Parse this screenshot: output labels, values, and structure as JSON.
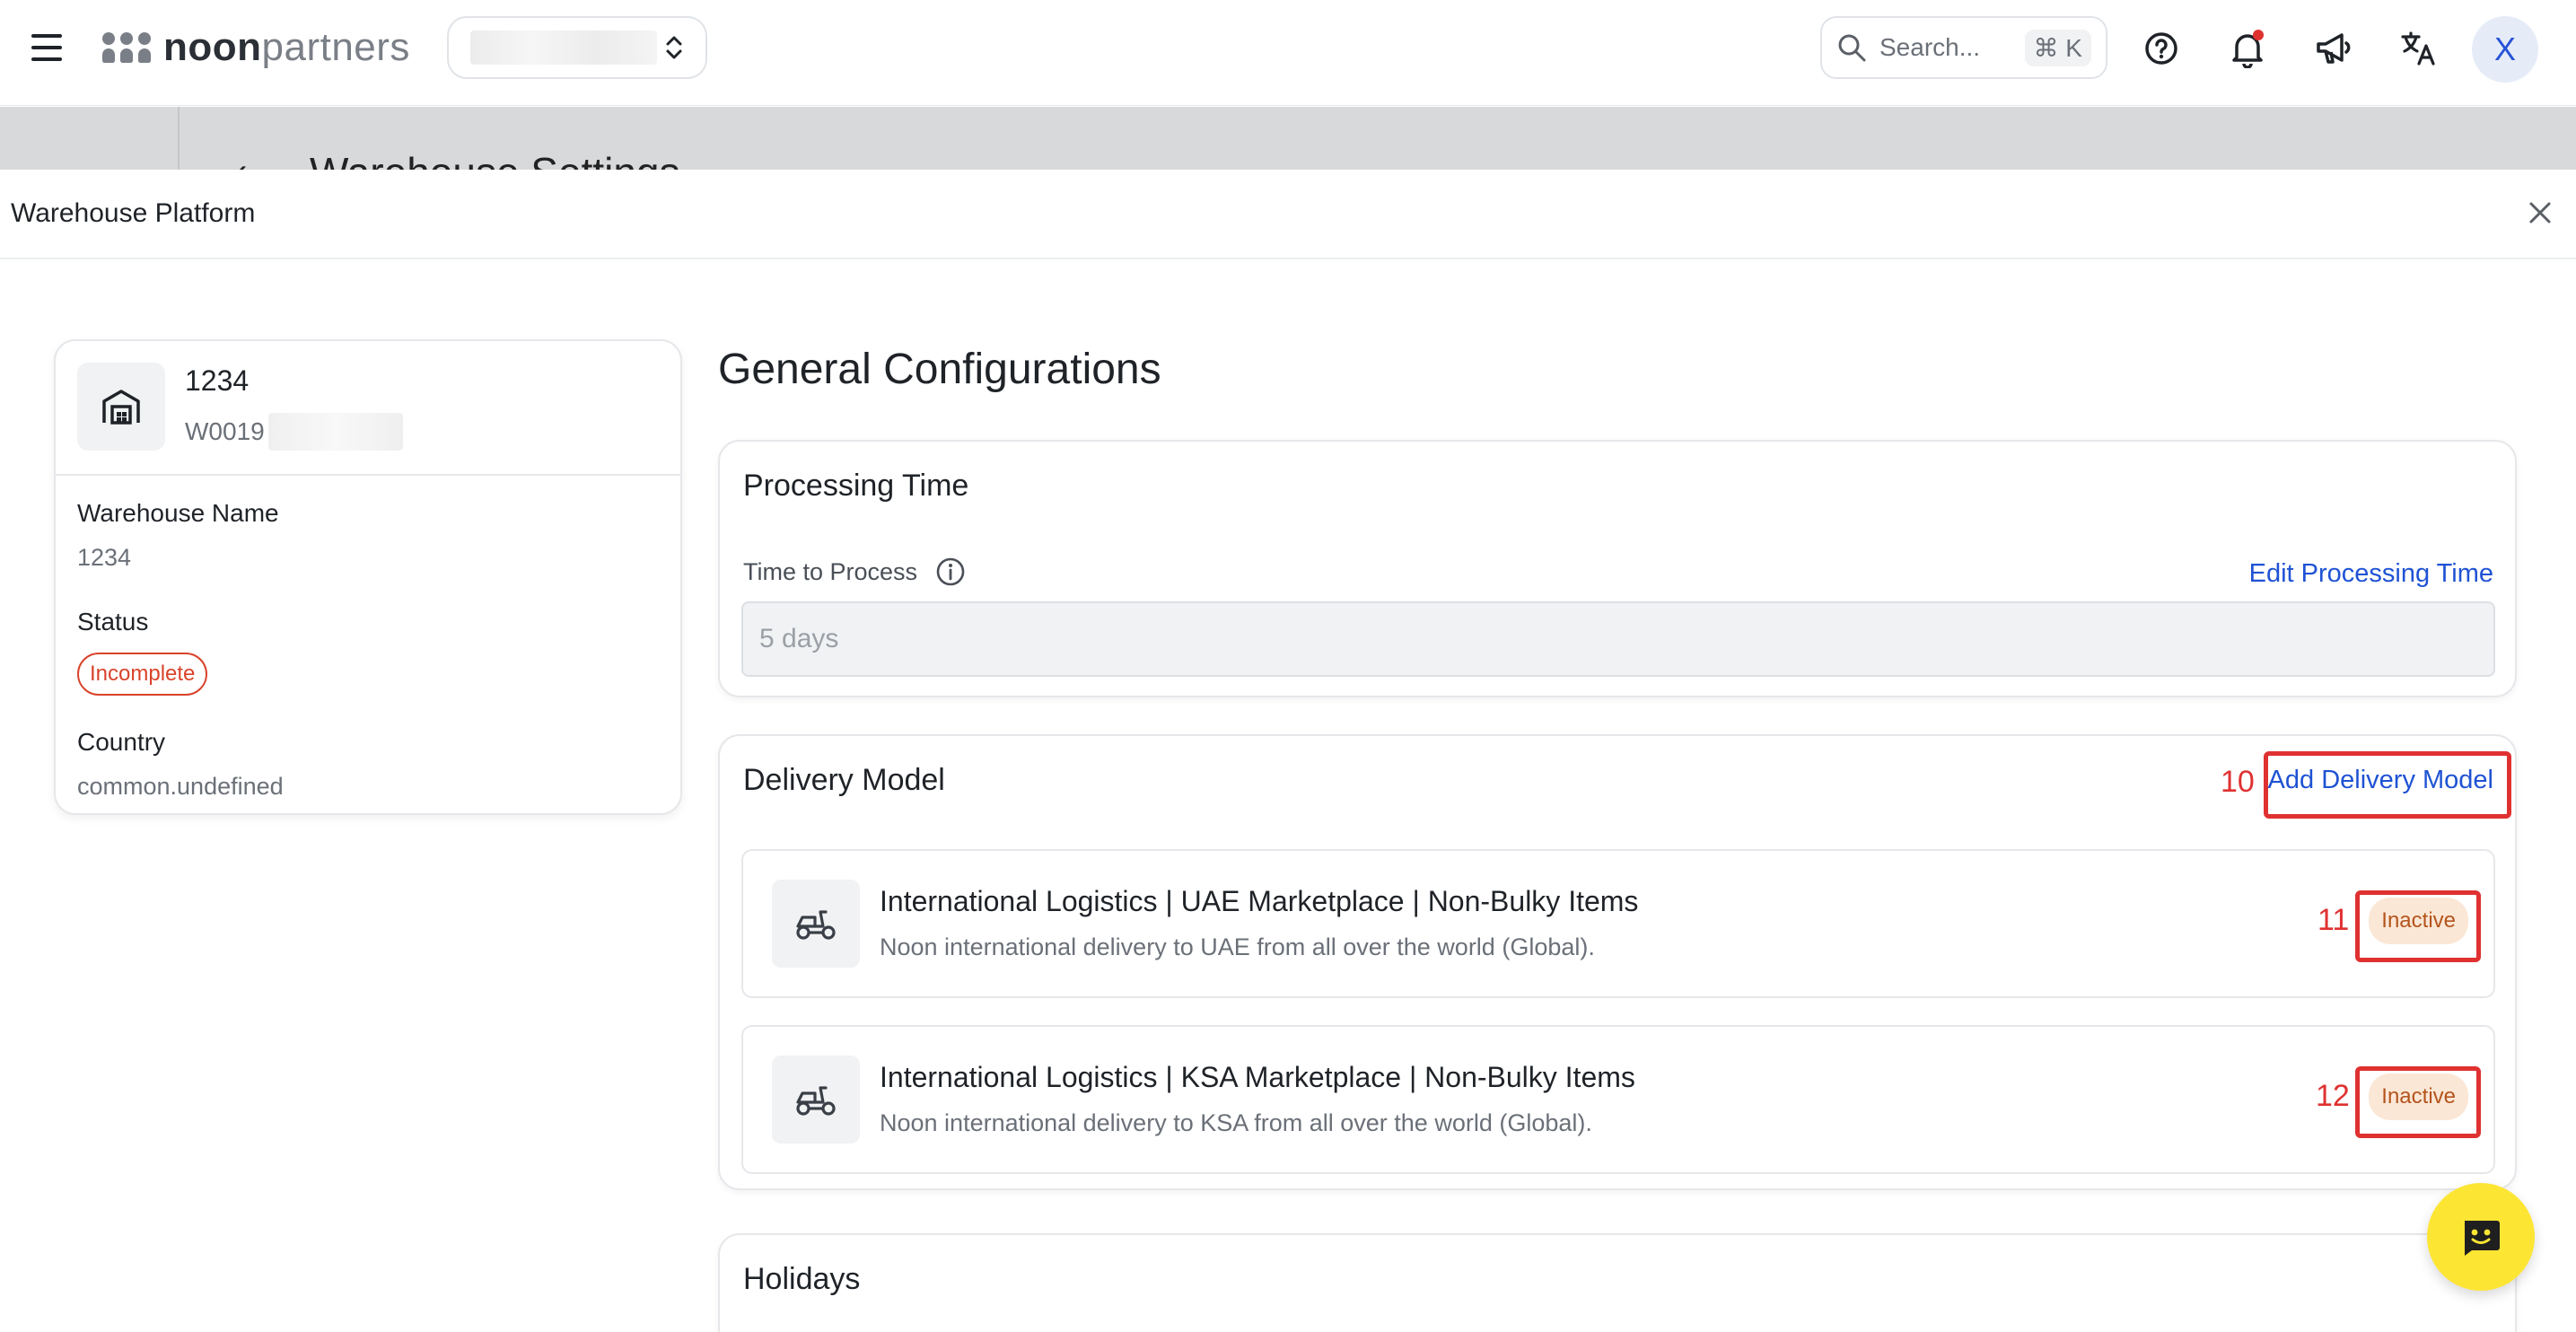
{
  "topbar": {
    "brand_bold": "noon",
    "brand_light": "partners",
    "search_placeholder": "Search...",
    "search_shortcut": "⌘ K",
    "avatar_initial": "X"
  },
  "background": {
    "page_title": "Warehouse Settings",
    "back_glyph": "‹"
  },
  "panel": {
    "title": "Warehouse Platform",
    "close_glyph": "✕"
  },
  "warehouse": {
    "id": "1234",
    "code_prefix": "W0019",
    "name_label": "Warehouse Name",
    "name_value": "1234",
    "status_label": "Status",
    "status_value": "Incomplete",
    "country_label": "Country",
    "country_value": "common.undefined"
  },
  "general": {
    "title": "General Configurations"
  },
  "processing": {
    "title": "Processing Time",
    "field_label": "Time to Process",
    "edit_link": "Edit Processing Time",
    "value": "5 days"
  },
  "delivery": {
    "title": "Delivery Model",
    "add_link": "Add Delivery Model",
    "add_marker": "10",
    "models": [
      {
        "title": "International Logistics | UAE Marketplace | Non-Bulky Items",
        "description": "Noon international delivery to UAE from all over the world (Global).",
        "status": "Inactive",
        "marker": "11"
      },
      {
        "title": "International Logistics | KSA Marketplace | Non-Bulky Items",
        "description": "Noon international delivery to KSA from all over the world (Global).",
        "status": "Inactive",
        "marker": "12"
      }
    ]
  },
  "holidays": {
    "title": "Holidays"
  },
  "colors": {
    "accent_link": "#1f52d4",
    "status_incomplete": "#d9432b",
    "inactive_bg": "#fbe7d6",
    "inactive_text": "#b4541c",
    "annotation_red": "#e03131",
    "chat_fab": "#fde534"
  },
  "icons": [
    "menu-icon",
    "noon-logo-icon",
    "updown-chevron-icon",
    "search-icon",
    "help-icon",
    "bell-icon",
    "megaphone-icon",
    "translate-icon",
    "close-icon",
    "warehouse-icon",
    "info-icon",
    "scooter-icon",
    "chat-bot-icon"
  ]
}
